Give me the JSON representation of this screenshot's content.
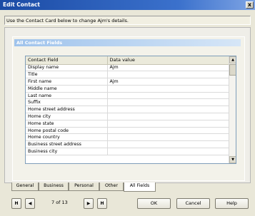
{
  "window": {
    "title": "Edit Contact",
    "close_glyph": "x"
  },
  "instruction": "Use the Contact Card below to change Ajm's details.",
  "panel": {
    "header": "All Contact Fields"
  },
  "grid": {
    "columns": [
      "Contact Field",
      "Data value"
    ],
    "rows": [
      [
        "Display name",
        "Ajm"
      ],
      [
        "Title",
        ""
      ],
      [
        "First name",
        "Ajm"
      ],
      [
        "Middle name",
        ""
      ],
      [
        "Last name",
        ""
      ],
      [
        "Suffix",
        ""
      ],
      [
        "Home street address",
        ""
      ],
      [
        "Home city",
        ""
      ],
      [
        "Home state",
        ""
      ],
      [
        "Home postal code",
        ""
      ],
      [
        "Home country",
        ""
      ],
      [
        "Business street address",
        ""
      ],
      [
        "Business city",
        ""
      ]
    ]
  },
  "tabs": [
    {
      "label": "General",
      "active": false
    },
    {
      "label": "Business",
      "active": false
    },
    {
      "label": "Personal",
      "active": false
    },
    {
      "label": "Other",
      "active": false
    },
    {
      "label": "All Fields",
      "active": true
    }
  ],
  "nav": {
    "first": "H",
    "prev": "◀",
    "page_text": "7 of 13",
    "next": "▶",
    "last": "H",
    "ok": "OK",
    "cancel": "Cancel",
    "help": "Help"
  }
}
